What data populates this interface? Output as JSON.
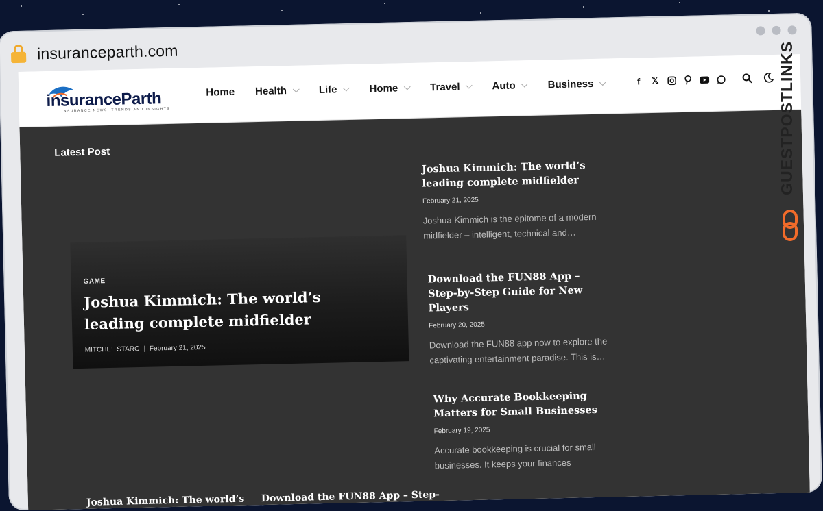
{
  "browser": {
    "url": "insuranceparth.com"
  },
  "header": {
    "logo_text": "insuranceParth",
    "logo_tagline": "INSURANCE NEWS, TRENDS AND INSIGHTS",
    "nav": [
      {
        "label": "Home",
        "dropdown": false
      },
      {
        "label": "Health",
        "dropdown": true
      },
      {
        "label": "Life",
        "dropdown": true
      },
      {
        "label": "Home",
        "dropdown": true
      },
      {
        "label": "Travel",
        "dropdown": true
      },
      {
        "label": "Auto",
        "dropdown": true
      },
      {
        "label": "Business",
        "dropdown": true
      }
    ],
    "social_icons": [
      "facebook-icon",
      "x-icon",
      "instagram-icon",
      "pinterest-icon",
      "youtube-icon",
      "whatsapp-icon"
    ],
    "tools": [
      "search-icon",
      "dark-mode-icon"
    ]
  },
  "main": {
    "section_title": "Latest Post",
    "hero": {
      "category": "GAME",
      "title": "Joshua Kimmich: The world’s leading complete midfielder",
      "author": "MITCHEL STARC",
      "date": "February 21, 2025"
    },
    "posts": [
      {
        "title": "Joshua Kimmich: The world’s leading complete midfielder",
        "date": "February 21, 2025",
        "excerpt": "Joshua Kimmich is the epitome of a modern midfielder – intelligent, technical and…"
      },
      {
        "title": "Download the FUN88 App – Step-by-Step Guide for New Players",
        "date": "February 20, 2025",
        "excerpt": "Download the FUN88 app now to explore the captivating entertainment paradise. This is…"
      },
      {
        "title": "Why Accurate Bookkeeping Matters for Small Businesses",
        "date": "February 19, 2025",
        "excerpt": "Accurate bookkeeping is crucial for small businesses. It keeps your finances"
      }
    ],
    "bottom_peek": [
      "Joshua Kimmich: The world’s",
      "Download the FUN88 App – Step-"
    ]
  },
  "watermark": {
    "text": "GUESTPOSTLINKS"
  },
  "colors": {
    "content_bg": "#333333",
    "header_bg": "#ffffff",
    "brand_orange": "#f26b2a",
    "logo_navy": "#0d1b4a"
  }
}
